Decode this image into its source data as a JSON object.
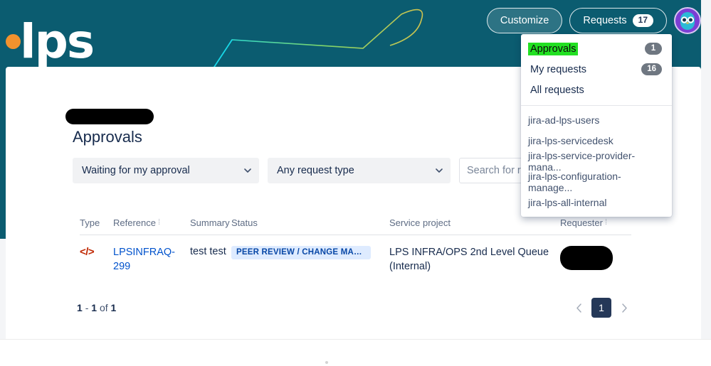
{
  "theme": {
    "banner_color": "#0b5c70",
    "accent_link": "#0052cc",
    "badge_bg": "#deebff",
    "badge_text": "#0747a6",
    "highlight_green": "#22e022",
    "page_active_bg": "#253858",
    "logo_dot_color": "#f2922e",
    "avatar_bg": "#7b3fd4"
  },
  "header": {
    "logo_text": "lps",
    "logo_dot": "orange-dot-icon",
    "customize_label": "Customize",
    "requests_label": "Requests",
    "requests_count": "17",
    "avatar_icon": "owl-avatar-icon"
  },
  "dropdown": {
    "items": [
      {
        "label": "Approvals",
        "count": "1",
        "selected": true
      },
      {
        "label": "My requests",
        "count": "16",
        "selected": false
      },
      {
        "label": "All requests",
        "count": "",
        "selected": false
      }
    ],
    "groups": [
      {
        "label": "jira-ad-lps-users"
      },
      {
        "label": "jira-lps-servicedesk"
      },
      {
        "label": "jira-lps-service-provider-mana..."
      },
      {
        "label": "jira-lps-configuration-manage..."
      },
      {
        "label": "jira-lps-all-internal"
      }
    ]
  },
  "main": {
    "page_title": "Approvals",
    "breadcrumb_masked": "",
    "filters": {
      "approval_status": "Waiting for my approval",
      "request_type": "Any request type",
      "search_placeholder": "Search for requests"
    },
    "table": {
      "columns": [
        {
          "label": "Type",
          "sortable": false
        },
        {
          "label": "Reference",
          "sortable": true
        },
        {
          "label": "Summary",
          "sortable": false
        },
        {
          "label": "Status",
          "sortable": false
        },
        {
          "label": "Service project",
          "sortable": false
        },
        {
          "label": "Requester",
          "sortable": true
        }
      ],
      "sort_indicator": "⁞",
      "rows": [
        {
          "type_icon": "code-icon",
          "type_glyph": "</>",
          "reference": "LPSINFRAQ-299",
          "summary": "test test",
          "status": "PEER REVIEW / CHANGE MANAGE...",
          "service_project": "LPS INFRA/OPS 2nd Level Queue (Internal)",
          "requester_masked": ""
        }
      ]
    },
    "pagination": {
      "range_start": "1",
      "range_end": "1",
      "of_label": "of",
      "total": "1",
      "dash": "-",
      "prev_icon": "chevron-left-icon",
      "next_icon": "chevron-right-icon",
      "current_page": "1"
    }
  }
}
